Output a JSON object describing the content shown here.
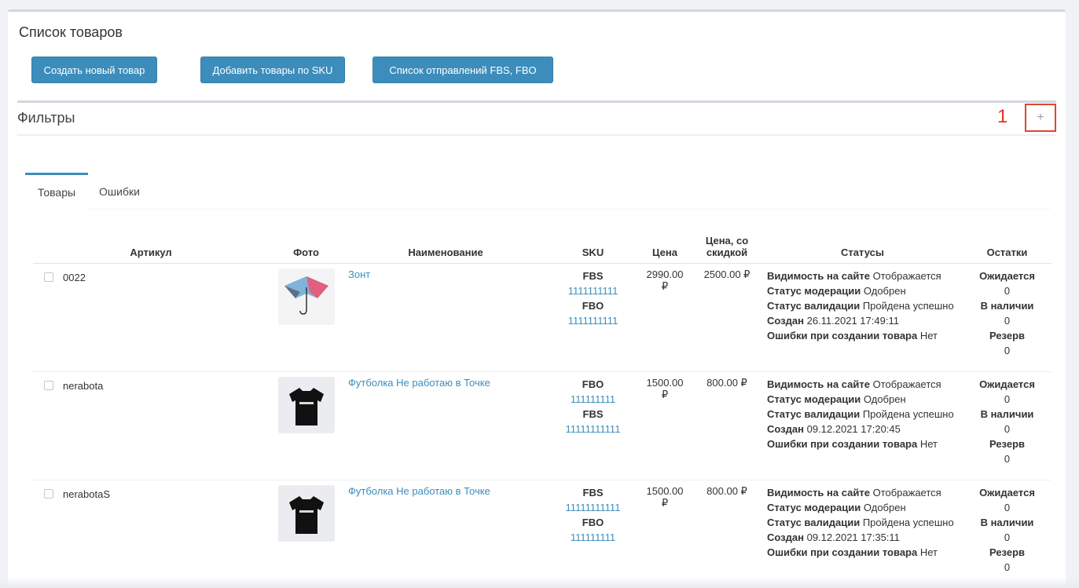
{
  "page_title": "Список товаров",
  "buttons": {
    "create": "Создать новый товар",
    "add_sku": "Добавить товары по SKU",
    "shipments": "Список отправлений FBS, FBO"
  },
  "filters": {
    "title": "Фильтры",
    "annotation": "1",
    "toggle": "+"
  },
  "tabs": [
    "Товары",
    "Ошибки"
  ],
  "columns": {
    "article": "Артикул",
    "photo": "Фото",
    "name": "Наименование",
    "sku": "SKU",
    "price": "Цена",
    "discount_price": "Цена, со скидкой",
    "statuses": "Статусы",
    "stock": "Остатки"
  },
  "rows": [
    {
      "article": "0022",
      "photo": "umbrella-image",
      "name": "Зонт",
      "sku": [
        {
          "label": "FBS",
          "value": "1111111111"
        },
        {
          "label": "FBO",
          "value": "1111111111"
        }
      ],
      "price": "2990.00 ₽",
      "discount_price": "2500.00 ₽",
      "statuses": {
        "visibility_label": "Видимость на сайте",
        "visibility": "Отображается",
        "moderation_label": "Статус модерации",
        "moderation": "Одобрен",
        "validation_label": "Статус валидации",
        "validation": "Пройдена успешно",
        "created_label": "Создан",
        "created": "26.11.2021 17:49:11",
        "errors_label": "Ошибки при создании товара",
        "errors": "Нет"
      },
      "stock": {
        "expected_label": "Ожидается",
        "expected": "0",
        "available_label": "В наличии",
        "available": "0",
        "reserve_label": "Резерв",
        "reserve": "0"
      }
    },
    {
      "article": "nerabota",
      "photo": "tshirt-image",
      "name": "Футболка Не работаю в Точке",
      "sku": [
        {
          "label": "FBO",
          "value": "111111111"
        },
        {
          "label": "FBS",
          "value": "11111111111"
        }
      ],
      "price": "1500.00 ₽",
      "discount_price": "800.00 ₽",
      "statuses": {
        "visibility_label": "Видимость на сайте",
        "visibility": "Отображается",
        "moderation_label": "Статус модерации",
        "moderation": "Одобрен",
        "validation_label": "Статус валидации",
        "validation": "Пройдена успешно",
        "created_label": "Создан",
        "created": "09.12.2021 17:20:45",
        "errors_label": "Ошибки при создании товара",
        "errors": "Нет"
      },
      "stock": {
        "expected_label": "Ожидается",
        "expected": "0",
        "available_label": "В наличии",
        "available": "0",
        "reserve_label": "Резерв",
        "reserve": "0"
      }
    },
    {
      "article": "nerabotaS",
      "photo": "tshirt-image",
      "name": "Футболка Не работаю в Точке",
      "sku": [
        {
          "label": "FBS",
          "value": "11111111111"
        },
        {
          "label": "FBO",
          "value": "111111111"
        }
      ],
      "price": "1500.00 ₽",
      "discount_price": "800.00 ₽",
      "statuses": {
        "visibility_label": "Видимость на сайте",
        "visibility": "Отображается",
        "moderation_label": "Статус модерации",
        "moderation": "Одобрен",
        "validation_label": "Статус валидации",
        "validation": "Пройдена успешно",
        "created_label": "Создан",
        "created": "09.12.2021 17:35:11",
        "errors_label": "Ошибки при создании товара",
        "errors": "Нет"
      },
      "stock": {
        "expected_label": "Ожидается",
        "expected": "0",
        "available_label": "В наличии",
        "available": "0",
        "reserve_label": "Резерв",
        "reserve": "0"
      }
    }
  ],
  "colors": {
    "primary": "#3c8dbc",
    "annotation_red": "#e3432f",
    "background": "#f1f2f6"
  }
}
